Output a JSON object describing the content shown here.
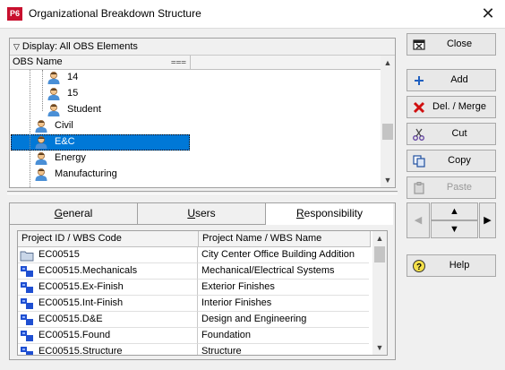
{
  "window": {
    "app_icon_text": "P6",
    "title": "Organizational Breakdown Structure",
    "close_glyph": "✕"
  },
  "obs": {
    "display_label": "Display: All OBS Elements",
    "column_header": "OBS Name",
    "items": [
      {
        "label": "14",
        "level": 2,
        "selected": false
      },
      {
        "label": "15",
        "level": 2,
        "selected": false
      },
      {
        "label": "Student",
        "level": 2,
        "selected": false
      },
      {
        "label": "Civil",
        "level": 1,
        "selected": false
      },
      {
        "label": "E&C",
        "level": 1,
        "selected": true
      },
      {
        "label": "Energy",
        "level": 1,
        "selected": false
      },
      {
        "label": "Manufacturing",
        "level": 1,
        "selected": false
      }
    ]
  },
  "tabs": [
    {
      "pre": "",
      "accel": "G",
      "post": "eneral",
      "active": false
    },
    {
      "pre": "",
      "accel": "U",
      "post": "sers",
      "active": false
    },
    {
      "pre": "",
      "accel": "R",
      "post": "esponsibility",
      "active": true
    }
  ],
  "grid": {
    "headers": [
      "Project ID / WBS Code",
      "Project Name / WBS Name"
    ],
    "rows": [
      {
        "code": "EC00515",
        "name": "City Center Office Building Addition",
        "icon": "folder-icon"
      },
      {
        "code": "EC00515.Mechanicals",
        "name": "Mechanical/Electrical Systems",
        "icon": "wbs-icon"
      },
      {
        "code": "EC00515.Ex-Finish",
        "name": "Exterior Finishes",
        "icon": "wbs-icon"
      },
      {
        "code": "EC00515.Int-Finish",
        "name": "Interior Finishes",
        "icon": "wbs-icon"
      },
      {
        "code": "EC00515.D&E",
        "name": "Design and Engineering",
        "icon": "wbs-icon"
      },
      {
        "code": "EC00515.Found",
        "name": "Foundation",
        "icon": "wbs-icon"
      },
      {
        "code": "EC00515.Structure",
        "name": "Structure",
        "icon": "wbs-icon"
      }
    ]
  },
  "buttons": {
    "close": "Close",
    "add": "Add",
    "delete_merge": "Del. / Merge",
    "cut": "Cut",
    "copy": "Copy",
    "paste": "Paste",
    "help": "Help"
  },
  "colors": {
    "selection": "#0078d7",
    "app_icon": "#c8102e",
    "wbs_icon": "#1f4fd1"
  }
}
